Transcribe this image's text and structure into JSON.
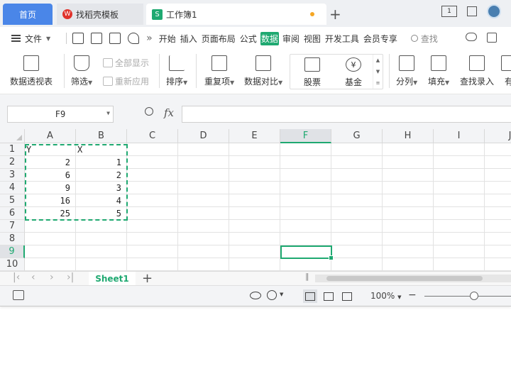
{
  "tabs": {
    "home": "首页",
    "template": "找稻壳模板",
    "template_icon": "W",
    "workbook": "工作簿1",
    "workbook_icon": "S",
    "new_tab": "+"
  },
  "window": {
    "page_count": "1"
  },
  "menu": {
    "file": "文件",
    "more": "»",
    "items": [
      "开始",
      "插入",
      "页面布局",
      "公式",
      "数据",
      "审阅",
      "视图",
      "开发工具",
      "会员专享"
    ],
    "active_item": "数据",
    "search": "查找"
  },
  "ribbon": {
    "pivot": "数据透视表",
    "filter": "筛选",
    "show_all": "全部显示",
    "reapply": "重新应用",
    "sort": "排序",
    "dup": "重复项",
    "compare": "数据对比",
    "stock": "股票",
    "fund": "基金",
    "fund_symbol": "¥",
    "split": "分列",
    "fill": "填充",
    "lookup": "查找录入",
    "more": "有"
  },
  "formula_bar": {
    "name_box": "F9",
    "fx": "fx",
    "formula": ""
  },
  "grid": {
    "columns": [
      "A",
      "B",
      "C",
      "D",
      "E",
      "F",
      "G",
      "H",
      "I",
      "J"
    ],
    "selected_column": "F",
    "rows": [
      "1",
      "2",
      "3",
      "4",
      "5",
      "6",
      "7",
      "8",
      "9",
      "10"
    ],
    "selected_row": "9",
    "headers": {
      "A1": "Y",
      "B1": "X"
    },
    "data": [
      {
        "y": "2",
        "x": "1"
      },
      {
        "y": "6",
        "x": "2"
      },
      {
        "y": "9",
        "x": "3"
      },
      {
        "y": "16",
        "x": "4"
      },
      {
        "y": "25",
        "x": "5"
      }
    ]
  },
  "sheets": {
    "active": "Sheet1",
    "add": "+"
  },
  "status": {
    "zoom": "100%",
    "zoom_slider_percent": 57,
    "minus": "−"
  },
  "colors": {
    "accent": "#1fa971",
    "home_tab": "#4a86e8"
  }
}
